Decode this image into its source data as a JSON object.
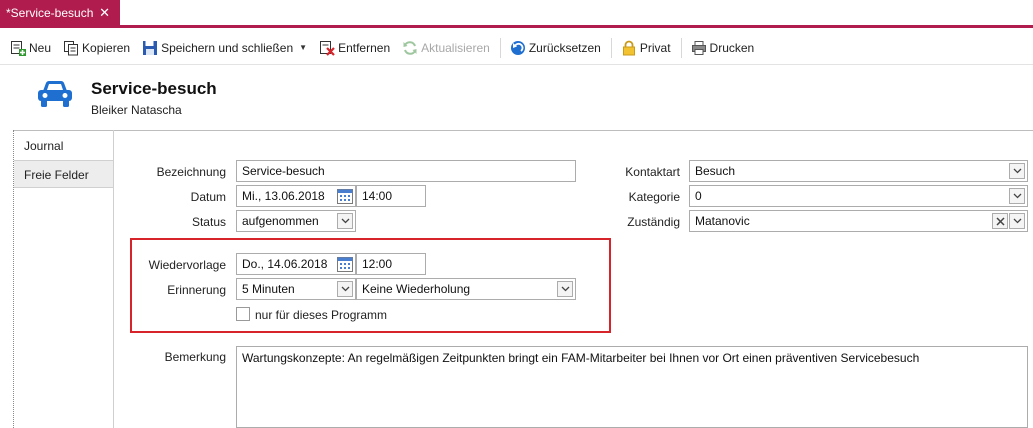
{
  "tab": {
    "title": "*Service-besuch",
    "close": "✕"
  },
  "toolbar": {
    "neu": "Neu",
    "kopieren": "Kopieren",
    "speichern": "Speichern und schließen",
    "entfernen": "Entfernen",
    "aktualisieren": "Aktualisieren",
    "zuruecksetzen": "Zurücksetzen",
    "privat": "Privat",
    "drucken": "Drucken"
  },
  "header": {
    "title": "Service-besuch",
    "subtitle": "Bleiker Natascha"
  },
  "sidebar": {
    "items": [
      {
        "label": "Journal"
      },
      {
        "label": "Freie Felder"
      }
    ]
  },
  "form": {
    "bezeichnung_label": "Bezeichnung",
    "bezeichnung_value": "Service-besuch",
    "datum_label": "Datum",
    "datum_value": "Mi., 13.06.2018",
    "datum_time": "14:00",
    "status_label": "Status",
    "status_value": "aufgenommen",
    "kontaktart_label": "Kontaktart",
    "kontaktart_value": "Besuch",
    "kategorie_label": "Kategorie",
    "kategorie_value": "0",
    "zustaendig_label": "Zuständig",
    "zustaendig_value": "Matanovic",
    "wiedervorlage_label": "Wiedervorlage",
    "wiedervorlage_value": "Do., 14.06.2018",
    "wiedervorlage_time": "12:00",
    "erinnerung_label": "Erinnerung",
    "erinnerung_value": "5 Minuten",
    "wiederholung_value": "Keine Wiederholung",
    "programm_label": "nur für dieses Programm",
    "bemerkung_label": "Bemerkung",
    "bemerkung_value": "Wartungskonzepte: An regelmäßigen Zeitpunkten bringt ein FAM-Mitarbeiter bei Ihnen vor Ort einen präventiven Servicebesuch"
  },
  "colors": {
    "accent": "#b01c4e",
    "highlight_box": "#d6242a",
    "car_icon": "#1f6fd1"
  }
}
